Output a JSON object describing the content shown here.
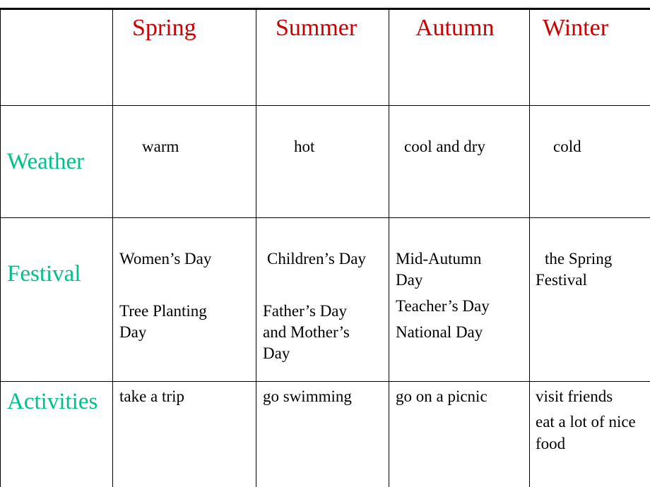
{
  "table": {
    "header": [
      "",
      "Spring",
      "Summer",
      "Autumn",
      "Winter"
    ],
    "rows": [
      {
        "label": "Weather",
        "cells": [
          [
            "warm"
          ],
          [
            "hot"
          ],
          [
            "cool and dry"
          ],
          [
            "cold"
          ]
        ]
      },
      {
        "label": "Festival",
        "cells": [
          [
            "Women’s  Day",
            "Tree Planting",
            "Day"
          ],
          [
            "Children’s Day",
            "Father’s Day",
            "and Mother’s",
            "Day"
          ],
          [
            "Mid-Autumn",
            "Day",
            "Teacher’s Day",
            "National Day"
          ],
          [
            "the Spring",
            "Festival"
          ]
        ]
      },
      {
        "label": "Activities",
        "cells": [
          [
            "take a trip"
          ],
          [
            "go  swimming"
          ],
          [
            "go on a picnic"
          ],
          [
            "visit  friends",
            "eat a lot of nice",
            "food"
          ]
        ]
      }
    ]
  },
  "colors": {
    "header": "#cc0000",
    "row_label": "#00c08a",
    "text": "#000000"
  }
}
